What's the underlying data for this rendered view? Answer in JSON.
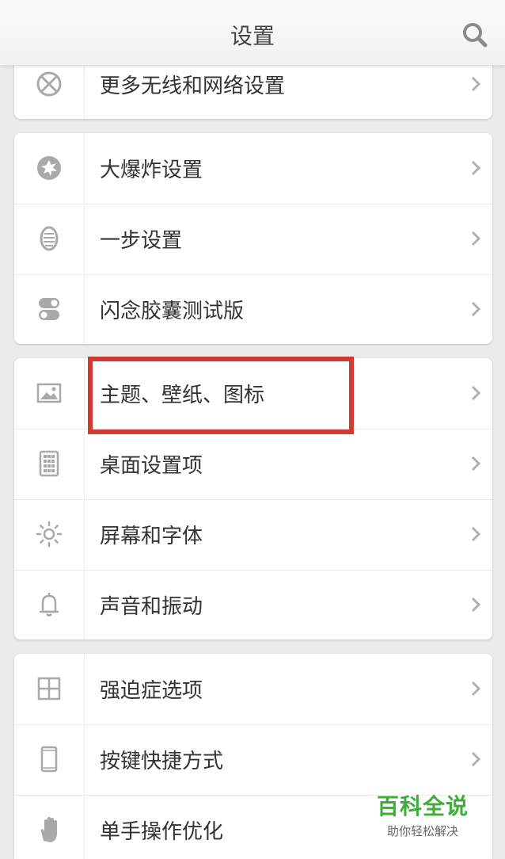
{
  "header": {
    "title": "设置",
    "search_icon": "search-icon"
  },
  "groups": [
    {
      "items": [
        {
          "label": "更多无线和网络设置",
          "icon": "wireless-network-icon"
        }
      ]
    },
    {
      "items": [
        {
          "label": "大爆炸设置",
          "icon": "big-bang-icon"
        },
        {
          "label": "一步设置",
          "icon": "one-step-icon"
        },
        {
          "label": "闪念胶囊测试版",
          "icon": "capsule-toggle-icon"
        }
      ]
    },
    {
      "items": [
        {
          "label": "主题、壁纸、图标",
          "icon": "image-icon"
        },
        {
          "label": "桌面设置项",
          "icon": "grid-phone-icon"
        },
        {
          "label": "屏幕和字体",
          "icon": "brightness-icon"
        },
        {
          "label": "声音和振动",
          "icon": "bell-icon"
        }
      ]
    },
    {
      "items": [
        {
          "label": "强迫症选项",
          "icon": "grid-square-icon"
        },
        {
          "label": "按键快捷方式",
          "icon": "phone-outline-icon"
        },
        {
          "label": "单手操作优化",
          "icon": "hand-icon"
        }
      ]
    }
  ],
  "highlight_color": "#d13a32",
  "watermark": {
    "main": "百科全说",
    "sub": "助你轻松解决"
  }
}
